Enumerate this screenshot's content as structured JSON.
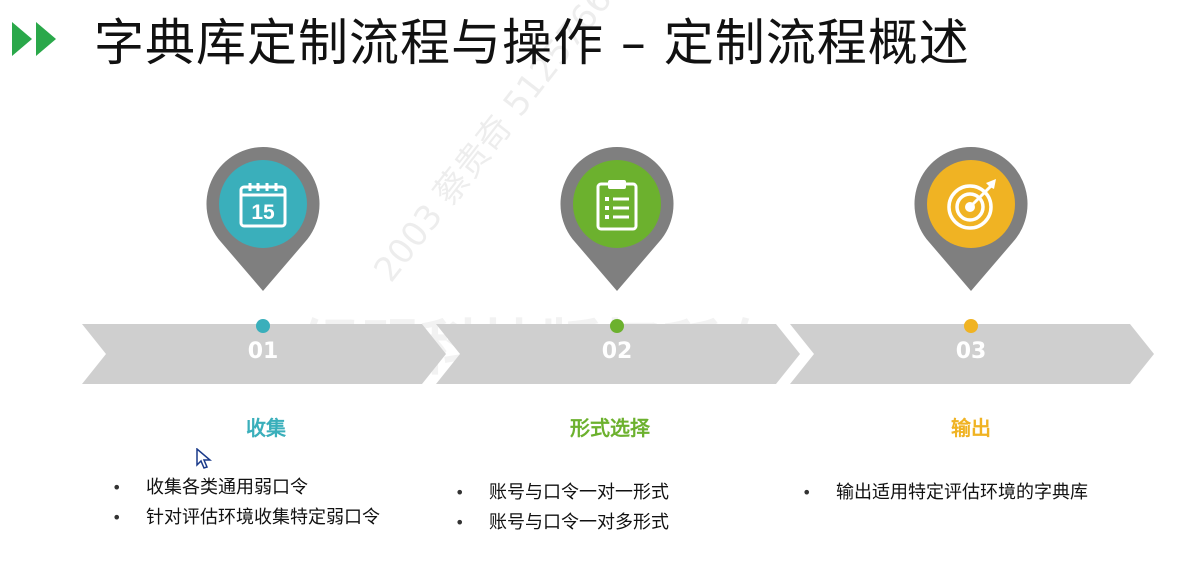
{
  "title": "字典库定制流程与操作 – 定制流程概述",
  "colors": {
    "title_arrows": "#2aa84a",
    "ribbon": "#cfcfcf",
    "pin_outer": "#7f7f7f",
    "step1": "#3aafbb",
    "step2": "#6cb12e",
    "step3": "#f0b323"
  },
  "steps": [
    {
      "number": "01",
      "title": "收集",
      "icon": "calendar-icon",
      "calendar_day": "15",
      "bullets": [
        "收集各类通用弱口令",
        "针对评估环境收集特定弱口令"
      ]
    },
    {
      "number": "02",
      "title": "形式选择",
      "icon": "clipboard-icon",
      "bullets": [
        "账号与口令一对一形式",
        "账号与口令一对多形式"
      ]
    },
    {
      "number": "03",
      "title": "输出",
      "icon": "target-icon",
      "bullets": [
        "输出适用特定评估环境的字典库"
      ]
    }
  ],
  "watermark": "2003 蔡贵奇 5125766 +8617780961",
  "watermark_large": "绿盟科技版权所有"
}
